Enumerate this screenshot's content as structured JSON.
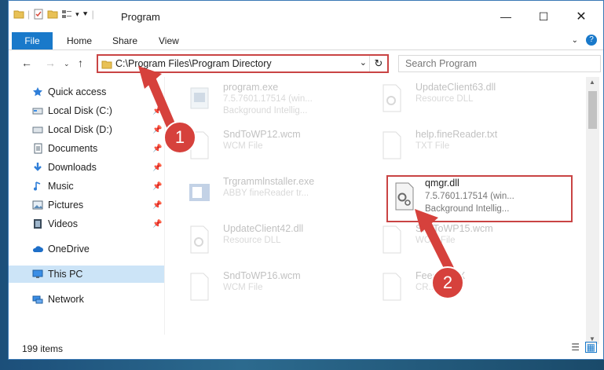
{
  "window": {
    "title": "Program"
  },
  "ribbon": {
    "tabs": [
      "File",
      "Home",
      "Share",
      "View"
    ]
  },
  "address": {
    "path": "C:\\Program Files\\Program Directory",
    "search_placeholder": "Search Program"
  },
  "sidebar": {
    "items": [
      {
        "label": "Quick access",
        "icon": "star-icon"
      },
      {
        "label": "Local Disk (C:)",
        "icon": "drive-icon"
      },
      {
        "label": "Local Disk (D:)",
        "icon": "drive-icon"
      },
      {
        "label": "Documents",
        "icon": "documents-icon"
      },
      {
        "label": "Downloads",
        "icon": "download-arrow-icon"
      },
      {
        "label": "Music",
        "icon": "music-note-icon"
      },
      {
        "label": "Pictures",
        "icon": "pictures-icon"
      },
      {
        "label": "Videos",
        "icon": "film-icon"
      },
      {
        "label": "OneDrive",
        "icon": "cloud-icon"
      },
      {
        "label": "This PC",
        "icon": "computer-icon"
      },
      {
        "label": "Network",
        "icon": "network-icon"
      }
    ]
  },
  "files": [
    {
      "name": "program.exe",
      "line1": "7.5.7601.17514 (win...",
      "line2": "Background Intellig..."
    },
    {
      "name": "UpdateClient63.dll",
      "line1": "Resource DLL",
      "line2": ""
    },
    {
      "name": "SndToWP12.wcm",
      "line1": "WCM File",
      "line2": ""
    },
    {
      "name": "help.fineReader.txt",
      "line1": "TXT File",
      "line2": ""
    },
    {
      "name": "Trgrammlnstaller.exe",
      "line1": "ABBY fineReader tr...",
      "line2": ""
    },
    {
      "name": "qmgr.dll",
      "line1": "7.5.7601.17514 (win...",
      "line2": "Background Intellig..."
    },
    {
      "name": "UpdateClient42.dll",
      "line1": "Resource DLL",
      "line2": ""
    },
    {
      "name": "SndToWP15.wcm",
      "line1": "WCM File",
      "line2": ""
    },
    {
      "name": "SndToWP16.wcm",
      "line1": "WCM File",
      "line2": ""
    },
    {
      "name": "FeedbackX",
      "line1": "CR...",
      "line2": ""
    }
  ],
  "status": {
    "count": "199 items"
  },
  "annotations": {
    "step1": "1",
    "step2": "2"
  },
  "colors": {
    "accent": "#1979ca",
    "highlight": "#c94444",
    "selected": "#cce4f7"
  }
}
